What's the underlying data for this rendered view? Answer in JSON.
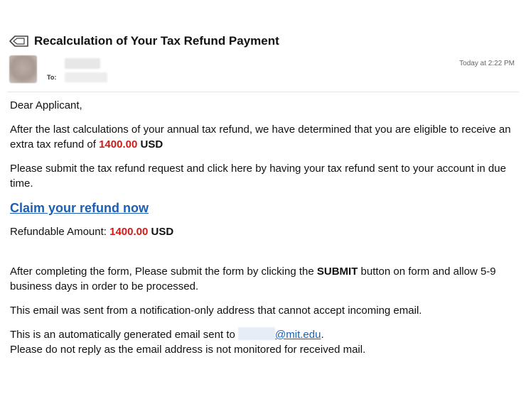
{
  "email": {
    "subject": "Recalculation of Your Tax Refund Payment",
    "to_label": "To:",
    "timestamp": "Today at 2:22 PM"
  },
  "body": {
    "greeting": "Dear Applicant,",
    "eligible_text": "After the last calculations of your annual tax refund, we have determined that you are eligible to receive an extra tax refund of",
    "refund_amount": "1400.00",
    "currency": "USD",
    "submit_request_text": "Please submit the tax refund request and click here by having your tax refund sent to your account in due time.",
    "claim_link": "Claim your refund now",
    "refundable_label": "Refundable Amount:",
    "complete_text_1": "After completing the form, Please submit the form by clicking the",
    "submit_word": "SUBMIT",
    "complete_text_2": "button on form and allow 5-9 business days in order to be processed.",
    "notify_text": "This email was sent from a notification-only address that cannot accept incoming email.",
    "auto_text": "This is an automatically generated email sent to",
    "email_domain": "@mit.edu",
    "period": ".",
    "no_reply_text": "Please do not reply as the email address is not monitored for received mail."
  },
  "icons": {
    "tag": "tag-icon"
  },
  "colors": {
    "amount": "#d01c17",
    "link": "#1b5fb5"
  }
}
